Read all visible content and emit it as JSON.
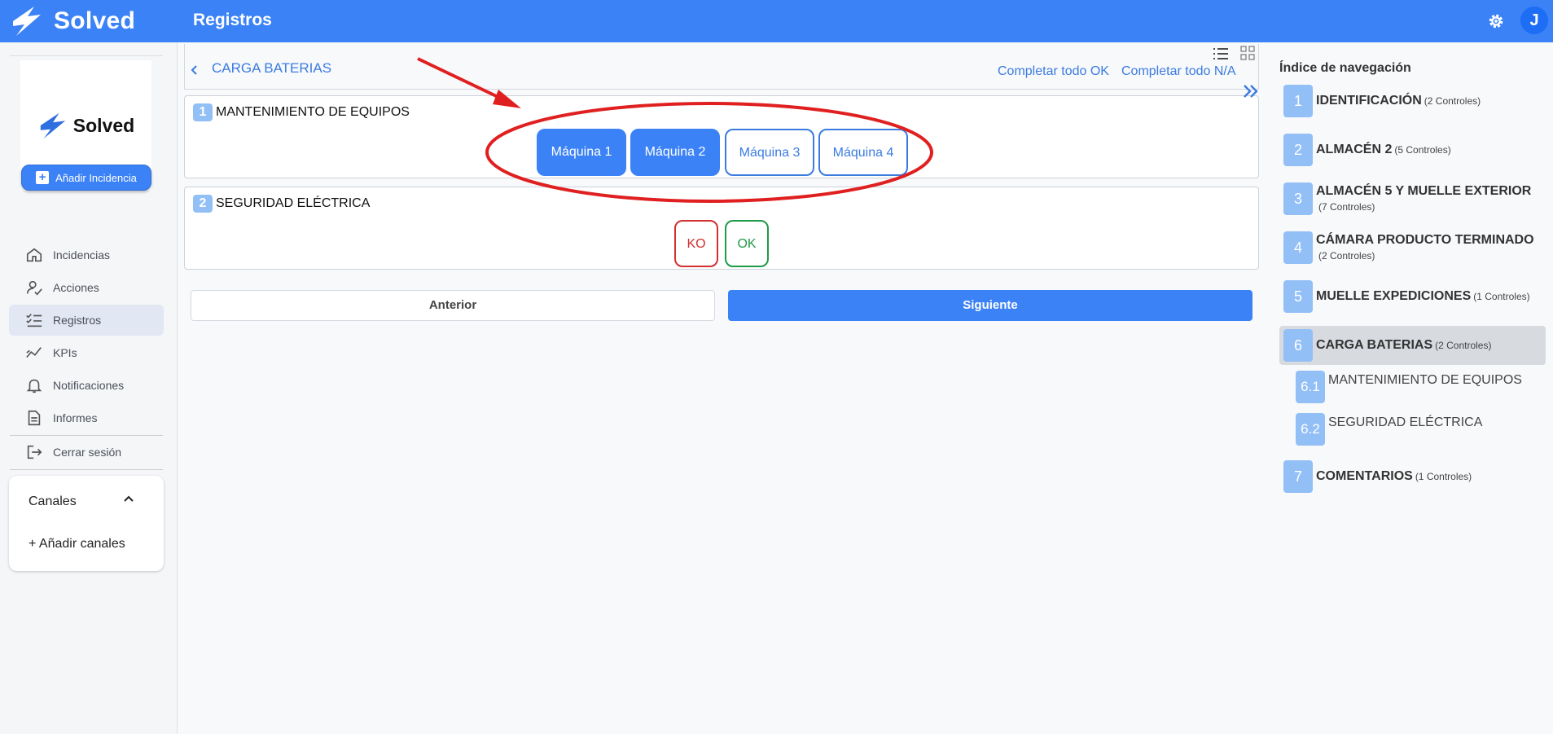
{
  "app": {
    "brand": "Solved",
    "page_title": "Registros",
    "user_initial": "J"
  },
  "sidebar": {
    "logo_text": "Solved",
    "add_incident_label": "Añadir Incidencia",
    "items": [
      {
        "label": "Incidencias",
        "icon": "home-icon"
      },
      {
        "label": "Acciones",
        "icon": "user-check-icon"
      },
      {
        "label": "Registros",
        "icon": "checklist-icon",
        "active": true
      },
      {
        "label": "KPIs",
        "icon": "trend-chart-icon"
      },
      {
        "label": "Notificaciones",
        "icon": "bell-icon"
      },
      {
        "label": "Informes",
        "icon": "document-icon"
      }
    ],
    "logout_label": "Cerrar sesión",
    "channels": {
      "title": "Canales",
      "add_label": "+ Añadir canales"
    }
  },
  "main": {
    "section_title": "CARGA BATERIAS",
    "complete_ok_label": "Completar todo OK",
    "complete_na_label": "Completar todo N/A",
    "questions": [
      {
        "number": "1",
        "title": "MANTENIMIENTO DE EQUIPOS",
        "options": [
          "Máquina 1",
          "Máquina 2",
          "Máquina 3",
          "Máquina 4"
        ],
        "selected": [
          "Máquina 1",
          "Máquina 2"
        ]
      },
      {
        "number": "2",
        "title": "SEGURIDAD ELÉCTRICA",
        "options": [
          "KO",
          "OK"
        ]
      }
    ],
    "prev_label": "Anterior",
    "next_label": "Siguiente",
    "annotation_color": "#e02020"
  },
  "nav_index": {
    "title": "Índice de navegación",
    "items": [
      {
        "num": "1",
        "label": "IDENTIFICACIÓN",
        "count": "(2 Controles)"
      },
      {
        "num": "2",
        "label": "ALMACÉN 2",
        "count": "(5 Controles)"
      },
      {
        "num": "3",
        "label": "ALMACÉN 5 Y MUELLE EXTERIOR",
        "count": "(7 Controles)"
      },
      {
        "num": "4",
        "label": "CÁMARA PRODUCTO TERMINADO",
        "count": "(2 Controles)"
      },
      {
        "num": "5",
        "label": "MUELLE EXPEDICIONES",
        "count": "(1 Controles)"
      },
      {
        "num": "6",
        "label": "CARGA BATERIAS",
        "count": "(2 Controles)",
        "active": true,
        "subitems": [
          {
            "num": "6.1",
            "label": "MANTENIMIENTO DE EQUIPOS"
          },
          {
            "num": "6.2",
            "label": "SEGURIDAD ELÉCTRICA"
          }
        ]
      },
      {
        "num": "7",
        "label": "COMENTARIOS",
        "count": "(1 Controles)"
      }
    ]
  },
  "colors": {
    "primary": "#3b82f6",
    "accent_light": "#93bff7",
    "ko": "#d32f2f",
    "ok": "#1f9a48"
  }
}
